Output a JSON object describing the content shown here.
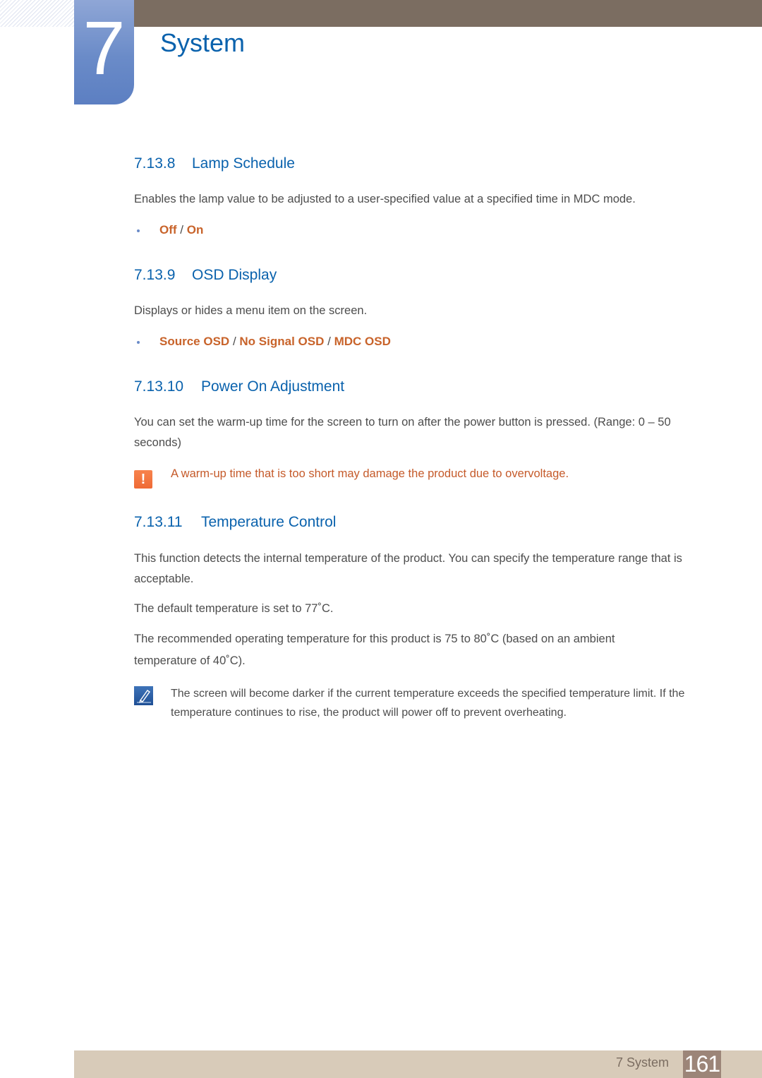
{
  "chapter": {
    "number": "7",
    "title": "System"
  },
  "sections": [
    {
      "number": "7.13.8",
      "title": "Lamp Schedule",
      "body": "Enables the lamp value to be adjusted to a user-specified value at a specified time in MDC mode.",
      "options": [
        "Off",
        "On"
      ]
    },
    {
      "number": "7.13.9",
      "title": "OSD Display",
      "body": "Displays or hides a menu item on the screen.",
      "options": [
        "Source OSD",
        "No Signal OSD",
        "MDC OSD"
      ]
    },
    {
      "number": "7.13.10",
      "title": "Power On Adjustment",
      "body": "You can set the warm-up time for the screen to turn on after the power button is pressed. (Range: 0 – 50 seconds)",
      "warning": "A warm-up time that is too short may damage the product due to overvoltage."
    },
    {
      "number": "7.13.11",
      "title": "Temperature Control",
      "body": "This function detects the internal temperature of the product. You can specify the temperature range that is acceptable.",
      "default_line": "The default temperature is set to 77˚C.",
      "recommended_line": "The recommended operating temperature for this product is 75 to 80˚C (based on an ambient temperature of 40˚C).",
      "note": "The screen will become darker if the current temperature exceeds the specified temperature limit. If the temperature continues to rise, the product will power off to prevent overheating."
    }
  ],
  "separator": "/",
  "icons": {
    "warning": "caution-icon",
    "note": "note-pen-icon"
  },
  "footer": {
    "label": "7 System",
    "page": "161"
  },
  "colors": {
    "heading": "#0a62ad",
    "option": "#c8632a",
    "warning_text": "#c55a2a",
    "top_bar": "#7b6d61",
    "footer_bar": "#d8cbb9",
    "page_box": "#9c8578"
  }
}
